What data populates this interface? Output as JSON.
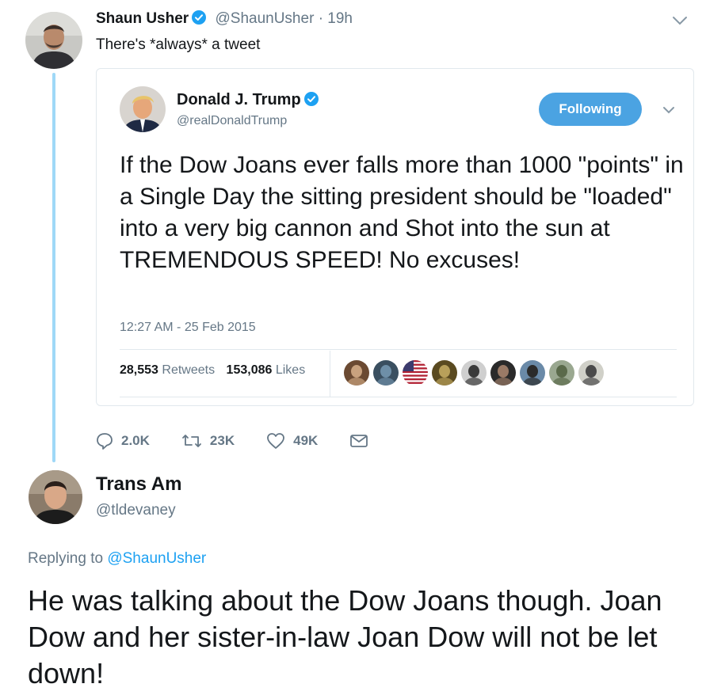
{
  "tweet": {
    "author_name": "Shaun Usher",
    "author_handle": "@ShaunUsher",
    "separator": "·",
    "time": "19h",
    "text": "There's *always* a tweet",
    "verified_icon": "verified-badge-icon",
    "caret_icon": "chevron-down-icon",
    "actions": {
      "replies": "2.0K",
      "retweets": "23K",
      "likes": "49K"
    }
  },
  "quoted_tweet": {
    "author_name": "Donald J. Trump",
    "author_handle": "@realDonaldTrump",
    "follow_label": "Following",
    "text": "If the Dow Joans ever falls more than 1000 \"points\" in a Single Day the sitting president should be \"loaded\" into a very big cannon and Shot into the sun at TREMENDOUS SPEED! No excuses!",
    "timestamp": "12:27 AM - 25 Feb 2015",
    "retweets_count": "28,553",
    "retweets_label": "Retweets",
    "likes_count": "153,086",
    "likes_label": "Likes",
    "liker_count": 9
  },
  "reply": {
    "author_name": "Trans Am",
    "author_handle": "@tldevaney",
    "replying_prefix": "Replying to",
    "replying_handle": "@ShaunUsher",
    "text": "He was talking about the Dow Joans though. Joan Dow and her sister-in-law Joan Dow will not be let down!"
  },
  "colors": {
    "link": "#1da1f2",
    "follow_button": "#4ba3e2",
    "thread_line": "#9fd8f7",
    "muted_text": "#657786",
    "border": "#e1e8ed"
  }
}
